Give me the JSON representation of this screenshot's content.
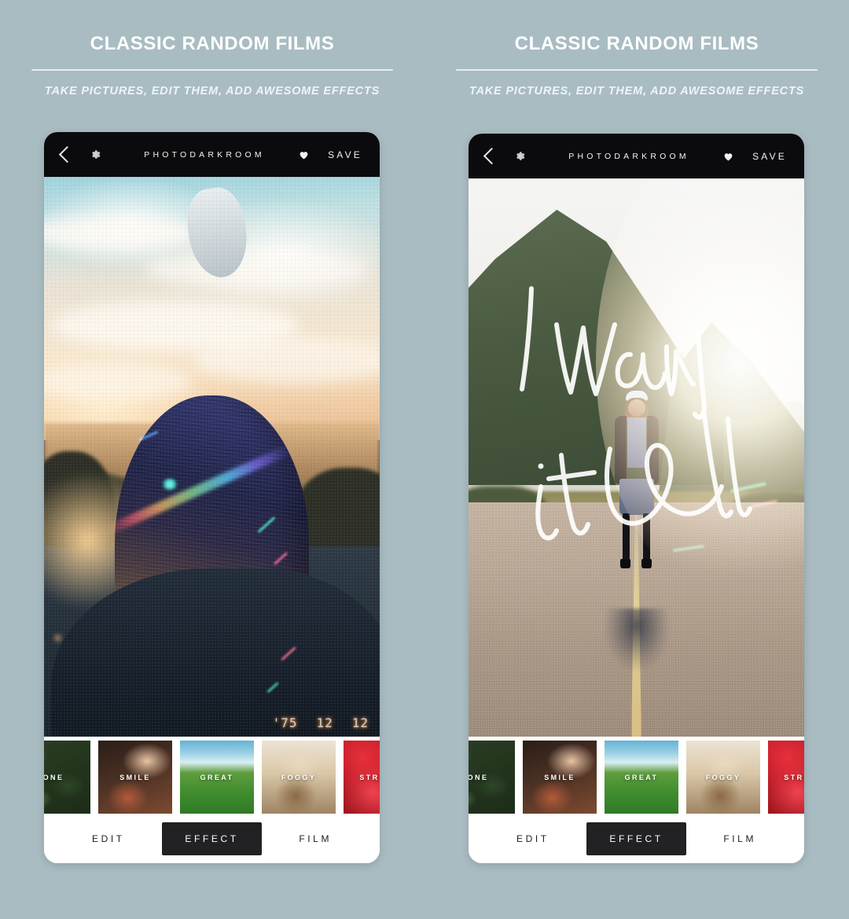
{
  "page": {
    "background_color": "#a9bcc2",
    "accent_dark": "#0b0b0d",
    "panel_surface": "#ffffff"
  },
  "panels": [
    {
      "heading": {
        "title": "CLASSIC RANDOM FILMS",
        "subtitle": "TAKE PICTURES, EDIT THEM, ADD AWESOME EFFECTS"
      },
      "app": {
        "appbar": {
          "back_icon": "chevron-left-icon",
          "settings_icon": "gear-icon",
          "brand": "PHOTODARKROOM",
          "favorite_icon": "heart-icon",
          "save_label": "SAVE"
        },
        "photo": {
          "description": "girl with bob haircut at sunset lake with rainbow prism flare",
          "datestamp": [
            "'75",
            "12",
            "12"
          ]
        },
        "filters": [
          {
            "label": "ONE"
          },
          {
            "label": "SMILE"
          },
          {
            "label": "GREAT"
          },
          {
            "label": "FOGGY"
          },
          {
            "label": "STRAWB"
          }
        ],
        "tabs": [
          {
            "label": "EDIT",
            "active": false
          },
          {
            "label": "EFFECT",
            "active": true
          },
          {
            "label": "FILM",
            "active": false
          }
        ]
      }
    },
    {
      "heading": {
        "title": "CLASSIC RANDOM FILMS",
        "subtitle": "TAKE PICTURES, EDIT THEM, ADD AWESOME EFFECTS"
      },
      "app": {
        "appbar": {
          "back_icon": "chevron-left-icon",
          "settings_icon": "gear-icon",
          "brand": "PHOTODARKROOM",
          "favorite_icon": "heart-icon",
          "save_label": "SAVE"
        },
        "photo": {
          "description": "woman standing on mountain road with handwritten overlay",
          "handwriting": "I want it all"
        },
        "filters": [
          {
            "label": "ONE"
          },
          {
            "label": "SMILE"
          },
          {
            "label": "GREAT"
          },
          {
            "label": "FOGGY"
          },
          {
            "label": "STRAWB"
          }
        ],
        "tabs": [
          {
            "label": "EDIT",
            "active": false
          },
          {
            "label": "EFFECT",
            "active": true
          },
          {
            "label": "FILM",
            "active": false
          }
        ]
      }
    }
  ]
}
